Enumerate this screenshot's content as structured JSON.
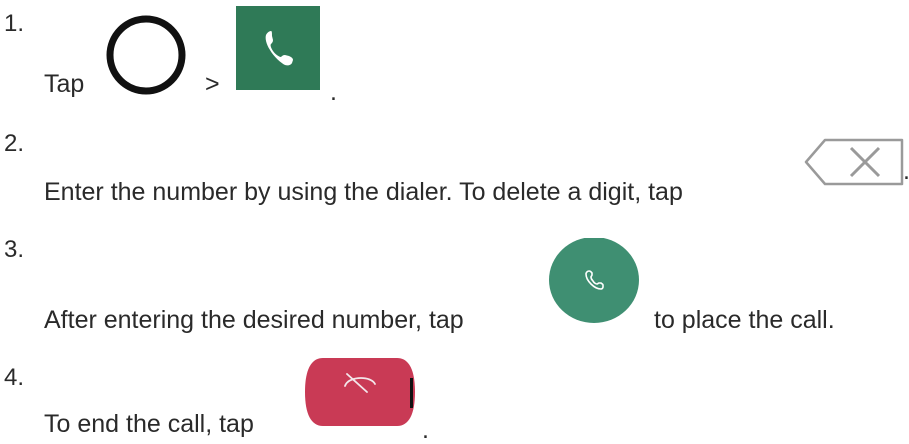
{
  "steps": [
    {
      "number": "1.",
      "text_before": "Tap",
      "separator": ">",
      "text_after": ".",
      "icons": [
        "home-circle-icon",
        "phone-app-icon"
      ]
    },
    {
      "number": "2.",
      "text_before": "Enter the number by using the dialer. To delete a digit, tap",
      "text_after": ".",
      "icons": [
        "backspace-delete-icon"
      ]
    },
    {
      "number": "3.",
      "text_before": "After entering the desired number, tap",
      "text_after": "to place the call.",
      "icons": [
        "call-button-icon"
      ]
    },
    {
      "number": "4.",
      "text_before": "To end the call, tap",
      "text_after": ".",
      "icons": [
        "end-call-button-icon"
      ]
    }
  ],
  "colors": {
    "text": "#2a2a2a",
    "phone_app_green": "#2f7a57",
    "call_green": "#3f8f72",
    "end_call_red": "#c93a55"
  }
}
